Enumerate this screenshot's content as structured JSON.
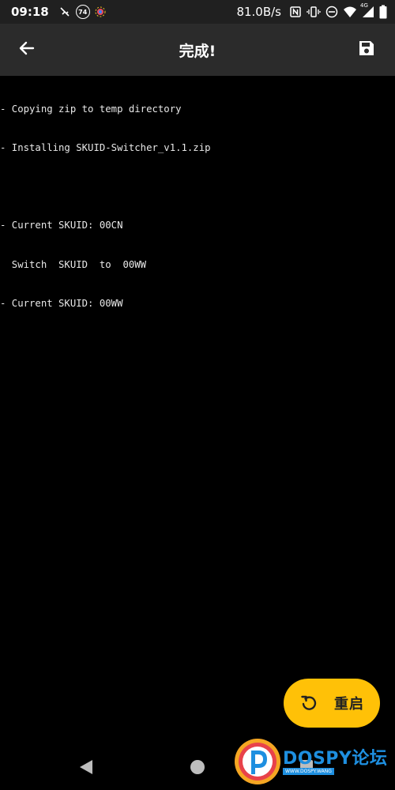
{
  "status_bar": {
    "time": "09:18",
    "badge_number": "74",
    "net_speed": "81.0B/s",
    "network_type": "4G",
    "icons": [
      "vpn-key-icon",
      "number-badge-icon",
      "app-notification-icon",
      "nfc-icon",
      "vibrate-icon",
      "do-not-disturb-icon",
      "wifi-icon",
      "signal-icon",
      "battery-icon"
    ]
  },
  "app_bar": {
    "title": "完成!",
    "back_icon": "arrow-back-icon",
    "save_icon": "save-icon"
  },
  "log": {
    "lines": [
      "- Copying zip to temp directory",
      "- Installing SKUID-Switcher_v1.1.zip",
      "",
      "- Current SKUID: 00CN",
      "  Switch  SKUID  to  00WW",
      "- Current SKUID: 00WW"
    ]
  },
  "fab": {
    "label": "重启",
    "icon": "reboot-icon",
    "color": "#ffc107"
  },
  "watermark": {
    "brand": "DOSPY",
    "brand_cn": "论坛",
    "sub": "WWW.DOSPY.WANG"
  },
  "colors": {
    "background": "#000000",
    "app_bar": "#2b2b2b",
    "status_bar": "#202020",
    "accent": "#ffc107",
    "watermark_blue": "#1e8fe0"
  }
}
